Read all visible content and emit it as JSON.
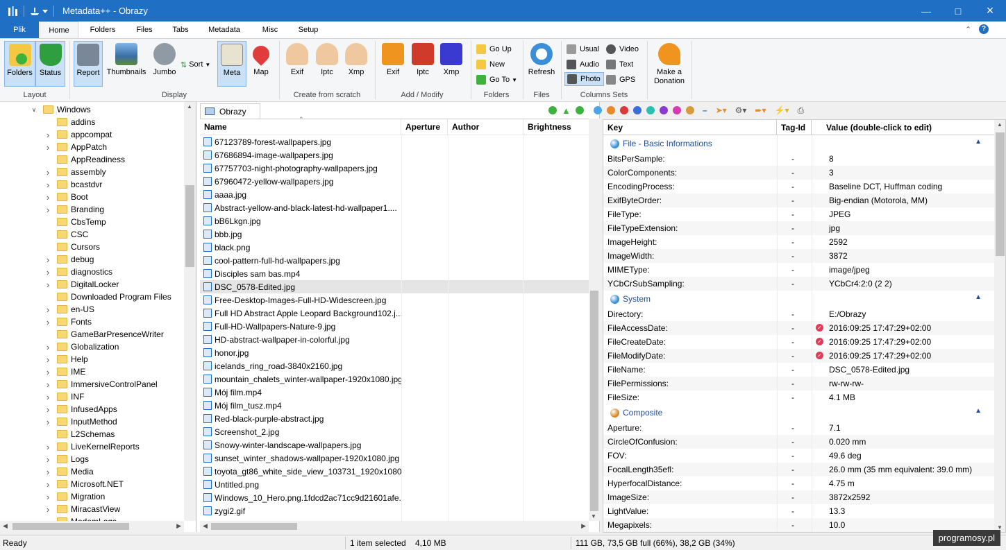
{
  "window": {
    "title": "Metadata++ - Obrazy"
  },
  "ribbon_tabs": [
    "Plik",
    "Home",
    "Folders",
    "Files",
    "Tabs",
    "Metadata",
    "Misc",
    "Setup"
  ],
  "ribbon": {
    "layout": {
      "folders": "Folders",
      "status": "Status",
      "group": "Layout"
    },
    "display": {
      "report": "Report",
      "thumbnails": "Thumbnails",
      "jumbo": "Jumbo",
      "sort": "Sort",
      "meta": "Meta",
      "map": "Map",
      "group": "Display"
    },
    "create": {
      "exif": "Exif",
      "iptc": "Iptc",
      "xmp": "Xmp",
      "group": "Create from scratch"
    },
    "add": {
      "exif": "Exif",
      "iptc": "Iptc",
      "xmp": "Xmp",
      "group": "Add / Modify"
    },
    "folders": {
      "goup": "Go Up",
      "new": "New",
      "goto": "Go To",
      "group": "Folders"
    },
    "files": {
      "refresh": "Refresh",
      "group": "Files"
    },
    "columns": {
      "usual": "Usual",
      "video": "Video",
      "audio": "Audio",
      "text": "Text",
      "photo": "Photo",
      "gps": "GPS",
      "group": "Columns Sets"
    },
    "donate": {
      "line1": "Make a",
      "line2": "Donation"
    }
  },
  "tree": {
    "root": "Windows",
    "items": [
      {
        "name": "addins",
        "exp": false
      },
      {
        "name": "appcompat",
        "exp": true
      },
      {
        "name": "AppPatch",
        "exp": true
      },
      {
        "name": "AppReadiness",
        "exp": false
      },
      {
        "name": "assembly",
        "exp": true
      },
      {
        "name": "bcastdvr",
        "exp": true
      },
      {
        "name": "Boot",
        "exp": true
      },
      {
        "name": "Branding",
        "exp": true
      },
      {
        "name": "CbsTemp",
        "exp": false
      },
      {
        "name": "CSC",
        "exp": false
      },
      {
        "name": "Cursors",
        "exp": false
      },
      {
        "name": "debug",
        "exp": true
      },
      {
        "name": "diagnostics",
        "exp": true
      },
      {
        "name": "DigitalLocker",
        "exp": true
      },
      {
        "name": "Downloaded Program Files",
        "exp": false
      },
      {
        "name": "en-US",
        "exp": true
      },
      {
        "name": "Fonts",
        "exp": true
      },
      {
        "name": "GameBarPresenceWriter",
        "exp": false
      },
      {
        "name": "Globalization",
        "exp": true
      },
      {
        "name": "Help",
        "exp": true
      },
      {
        "name": "IME",
        "exp": true
      },
      {
        "name": "ImmersiveControlPanel",
        "exp": true
      },
      {
        "name": "INF",
        "exp": true
      },
      {
        "name": "InfusedApps",
        "exp": true
      },
      {
        "name": "InputMethod",
        "exp": true
      },
      {
        "name": "L2Schemas",
        "exp": false
      },
      {
        "name": "LiveKernelReports",
        "exp": true
      },
      {
        "name": "Logs",
        "exp": true
      },
      {
        "name": "Media",
        "exp": true
      },
      {
        "name": "Microsoft.NET",
        "exp": true
      },
      {
        "name": "Migration",
        "exp": true
      },
      {
        "name": "MiracastView",
        "exp": true
      },
      {
        "name": "ModemLogs",
        "exp": false
      }
    ]
  },
  "files": {
    "tab": "Obrazy",
    "columns": [
      "Name",
      "Aperture",
      "Author",
      "Brightness"
    ],
    "rows": [
      "67123789-forest-wallpapers.jpg",
      "67686894-image-wallpapers.jpg",
      "67757703-night-photography-wallpapers.jpg",
      "67960472-yellow-wallpapers.jpg",
      "aaaa.jpg",
      "Abstract-yellow-and-black-latest-hd-wallpaper1....",
      "bB6Lkgn.jpg",
      "bbb.jpg",
      "black.png",
      "cool-pattern-full-hd-wallpapers.jpg",
      "Disciples sam bas.mp4",
      "DSC_0578-Edited.jpg",
      "Free-Desktop-Images-Full-HD-Widescreen.jpg",
      "Full HD Abstract Apple Leopard Background102.j...",
      "Full-HD-Wallpapers-Nature-9.jpg",
      "HD-abstract-wallpaper-in-colorful.jpg",
      "honor.jpg",
      "icelands_ring_road-3840x2160.jpg",
      "mountain_chalets_winter-wallpaper-1920x1080.jpg",
      "Mój film.mp4",
      "Mój film_tusz.mp4",
      "Red-black-purple-abstract.jpg",
      "Screenshot_2.jpg",
      "Snowy-winter-landscape-wallpapers.jpg",
      "sunset_winter_shadows-wallpaper-1920x1080.jpg",
      "toyota_gt86_white_side_view_103731_1920x1080.j...",
      "Untitled.png",
      "Windows_10_Hero.png.1fdcd2ac71cc9d21601afe...",
      "zygi2.gif"
    ],
    "selected_index": 11
  },
  "meta": {
    "headers": {
      "key": "Key",
      "tag": "Tag-Id",
      "value": "Value  (double-click to edit)"
    },
    "groups": [
      {
        "name": "File - Basic Informations",
        "color": "#3a8fd8",
        "rows": [
          {
            "k": "BitsPerSample:",
            "t": "-",
            "v": "8"
          },
          {
            "k": "ColorComponents:",
            "t": "-",
            "v": "3"
          },
          {
            "k": "EncodingProcess:",
            "t": "-",
            "v": "Baseline DCT, Huffman coding"
          },
          {
            "k": "ExifByteOrder:",
            "t": "-",
            "v": "Big-endian (Motorola, MM)"
          },
          {
            "k": "FileType:",
            "t": "-",
            "v": "JPEG"
          },
          {
            "k": "FileTypeExtension:",
            "t": "-",
            "v": "jpg"
          },
          {
            "k": "ImageHeight:",
            "t": "-",
            "v": "2592"
          },
          {
            "k": "ImageWidth:",
            "t": "-",
            "v": "3872"
          },
          {
            "k": "MIMEType:",
            "t": "-",
            "v": "image/jpeg"
          },
          {
            "k": "YCbCrSubSampling:",
            "t": "-",
            "v": "YCbCr4:2:0 (2 2)"
          }
        ]
      },
      {
        "name": "System",
        "color": "#3a8fd8",
        "rows": [
          {
            "k": "Directory:",
            "t": "-",
            "v": "E:/Obrazy"
          },
          {
            "k": "FileAccessDate:",
            "t": "-",
            "v": "2016:09:25 17:47:29+02:00",
            "edit": true
          },
          {
            "k": "FileCreateDate:",
            "t": "-",
            "v": "2016:09:25 17:47:29+02:00",
            "edit": true
          },
          {
            "k": "FileModifyDate:",
            "t": "-",
            "v": "2016:09:25 17:47:29+02:00",
            "edit": true
          },
          {
            "k": "FileName:",
            "t": "-",
            "v": "DSC_0578-Edited.jpg"
          },
          {
            "k": "FilePermissions:",
            "t": "-",
            "v": "rw-rw-rw-"
          },
          {
            "k": "FileSize:",
            "t": "-",
            "v": "4.1 MB"
          }
        ]
      },
      {
        "name": "Composite",
        "color": "#d9892a",
        "rows": [
          {
            "k": "Aperture:",
            "t": "-",
            "v": "7.1"
          },
          {
            "k": "CircleOfConfusion:",
            "t": "-",
            "v": "0.020 mm"
          },
          {
            "k": "FOV:",
            "t": "-",
            "v": "49.6 deg"
          },
          {
            "k": "FocalLength35efl:",
            "t": "-",
            "v": "26.0 mm (35 mm equivalent: 39.0 mm)"
          },
          {
            "k": "HyperfocalDistance:",
            "t": "-",
            "v": "4.75 m"
          },
          {
            "k": "ImageSize:",
            "t": "-",
            "v": "3872x2592"
          },
          {
            "k": "LightValue:",
            "t": "-",
            "v": "13.3"
          },
          {
            "k": "Megapixels:",
            "t": "-",
            "v": "10.0"
          }
        ]
      }
    ]
  },
  "status": {
    "ready": "Ready",
    "selected": "1 item selected",
    "size": "4,10 MB",
    "disk": "111 GB,  73,5 GB full (66%),  38,2 GB  (34%)"
  },
  "watermark": "programosy.pl"
}
